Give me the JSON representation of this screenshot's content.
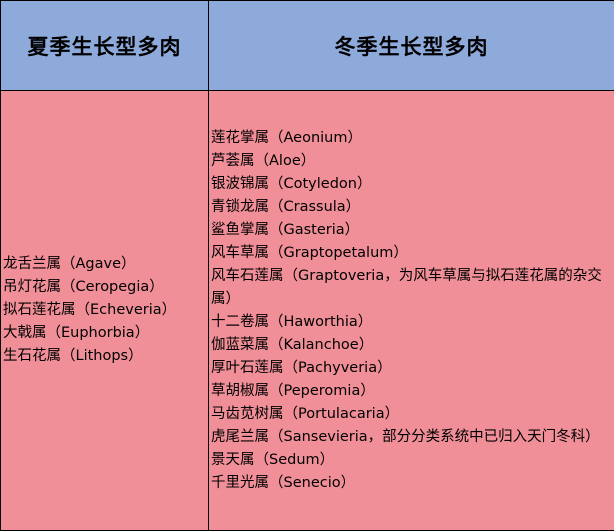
{
  "headers": {
    "summer": "夏季生长型多肉",
    "winter": "冬季生长型多肉"
  },
  "summer_genera": [
    "龙舌兰属（Agave）",
    "吊灯花属（Ceropegia）",
    "拟石莲花属（Echeveria）",
    "大戟属（Euphorbia）",
    "生石花属（Lithops）"
  ],
  "winter_genera": [
    "莲花掌属（Aeonium）",
    "芦荟属（Aloe）",
    "银波锦属（Cotyledon）",
    "青锁龙属（Crassula）",
    "鲨鱼掌属（Gasteria）",
    "风车草属（Graptopetalum）",
    "风车石莲属（Graptoveria，为风车草属与拟石莲花属的杂交属）",
    "十二卷属（Haworthia）",
    "伽蓝菜属（Kalanchoe）",
    "厚叶石莲属（Pachyveria）",
    "草胡椒属（Peperomia）",
    "马齿苋树属（Portulacaria）",
    "虎尾兰属（Sansevieria，部分分类系统中已归入天门冬科）",
    "景天属（Sedum）",
    "千里光属（Senecio）"
  ],
  "colors": {
    "header_bg": "#8eaadb",
    "body_bg": "#f08f98",
    "border": "#000000"
  }
}
